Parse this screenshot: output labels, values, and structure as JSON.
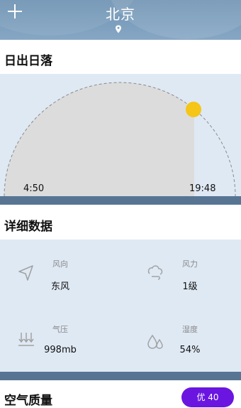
{
  "header": {
    "city": "北京",
    "add_icon": "plus-icon",
    "location_icon": "location-pin-icon",
    "bg_color": "#7a9cbb"
  },
  "sunrise_section": {
    "title": "日出日落",
    "sunrise_time": "4:50",
    "sunset_time": "19:48",
    "sun_color": "#f5c518"
  },
  "details_section": {
    "title": "详细数据",
    "items": [
      {
        "label": "风向",
        "value": "东风",
        "icon": "navigation-arrow-icon"
      },
      {
        "label": "风力",
        "value": "1级",
        "icon": "wind-icon"
      },
      {
        "label": "气压",
        "value": "998mb",
        "icon": "pressure-icon"
      },
      {
        "label": "湿度",
        "value": "54%",
        "icon": "humidity-drops-icon"
      }
    ]
  },
  "air_quality": {
    "title": "空气质量",
    "badge": "优 40",
    "badge_color": "#6a16e0"
  }
}
